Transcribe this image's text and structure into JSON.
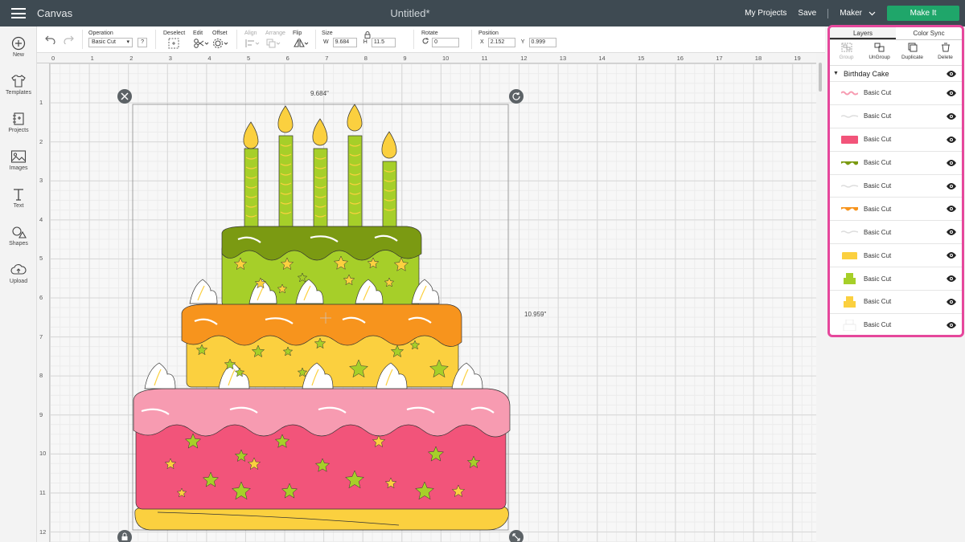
{
  "topbar": {
    "brand": "Canvas",
    "doc_title": "Untitled*",
    "my_projects": "My Projects",
    "save": "Save",
    "machine": "Maker",
    "make_it": "Make It"
  },
  "sidebar": {
    "items": [
      {
        "label": "New",
        "icon": "plus-circle-icon"
      },
      {
        "label": "Templates",
        "icon": "tshirt-icon"
      },
      {
        "label": "Projects",
        "icon": "projects-icon"
      },
      {
        "label": "Images",
        "icon": "image-icon"
      },
      {
        "label": "Text",
        "icon": "text-icon"
      },
      {
        "label": "Shapes",
        "icon": "shapes-icon"
      },
      {
        "label": "Upload",
        "icon": "upload-cloud-icon"
      }
    ]
  },
  "toolbar": {
    "operation_label": "Operation",
    "operation_value": "Basic Cut",
    "help": "?",
    "deselect": "Deselect",
    "edit": "Edit",
    "offset": "Offset",
    "align": "Align",
    "arrange": "Arrange",
    "flip": "Flip",
    "size_label": "Size",
    "w_label": "W",
    "w_value": "9.684",
    "h_label": "H",
    "h_value": "11.5",
    "rotate_label": "Rotate",
    "rotate_value": "0",
    "position_label": "Position",
    "x_label": "X",
    "x_value": "2.152",
    "y_label": "Y",
    "y_value": "0.999"
  },
  "rulers": {
    "top": [
      "0",
      "1",
      "2",
      "3",
      "4",
      "5",
      "6",
      "7",
      "8",
      "9",
      "10",
      "11",
      "12",
      "13",
      "14",
      "15",
      "16",
      "17",
      "18",
      "19"
    ],
    "left": [
      "1",
      "2",
      "3",
      "4",
      "5",
      "6",
      "7",
      "8",
      "9",
      "10",
      "11",
      "12"
    ]
  },
  "canvas": {
    "width_dim": "9.684\"",
    "height_dim": "10.959\""
  },
  "colors": {
    "accent_highlight": "#e6479c",
    "make_it": "#1fa66a",
    "topbar": "#3e4a52",
    "cake_pink": "#f2547a",
    "cake_light_pink": "#f79bb1",
    "cake_yellow": "#fbd03f",
    "cake_orange": "#f7941d",
    "cake_green": "#a6cf29",
    "cake_dark_green": "#7b9a12"
  },
  "layers_panel": {
    "tab_layers": "Layers",
    "tab_color_sync": "Color Sync",
    "actions": [
      "Group",
      "UnGroup",
      "Duplicate",
      "Delete"
    ],
    "group_name": "Birthday Cake",
    "layers": [
      {
        "name": "Basic Cut",
        "swatch": "pink-wave",
        "color": "#f79bb1"
      },
      {
        "name": "Basic Cut",
        "swatch": "white-line",
        "color": "#ffffff"
      },
      {
        "name": "Basic Cut",
        "swatch": "pink-block",
        "color": "#f2547a"
      },
      {
        "name": "Basic Cut",
        "swatch": "green-wave",
        "color": "#7b9a12"
      },
      {
        "name": "Basic Cut",
        "swatch": "white-line",
        "color": "#ffffff"
      },
      {
        "name": "Basic Cut",
        "swatch": "orange-wave",
        "color": "#f7941d"
      },
      {
        "name": "Basic Cut",
        "swatch": "white-line",
        "color": "#ffffff"
      },
      {
        "name": "Basic Cut",
        "swatch": "yellow-block",
        "color": "#fbd03f"
      },
      {
        "name": "Basic Cut",
        "swatch": "green-cake",
        "color": "#a6cf29"
      },
      {
        "name": "Basic Cut",
        "swatch": "yellow-cake",
        "color": "#fbd03f"
      },
      {
        "name": "Basic Cut",
        "swatch": "white-cake",
        "color": "#ffffff"
      }
    ]
  }
}
